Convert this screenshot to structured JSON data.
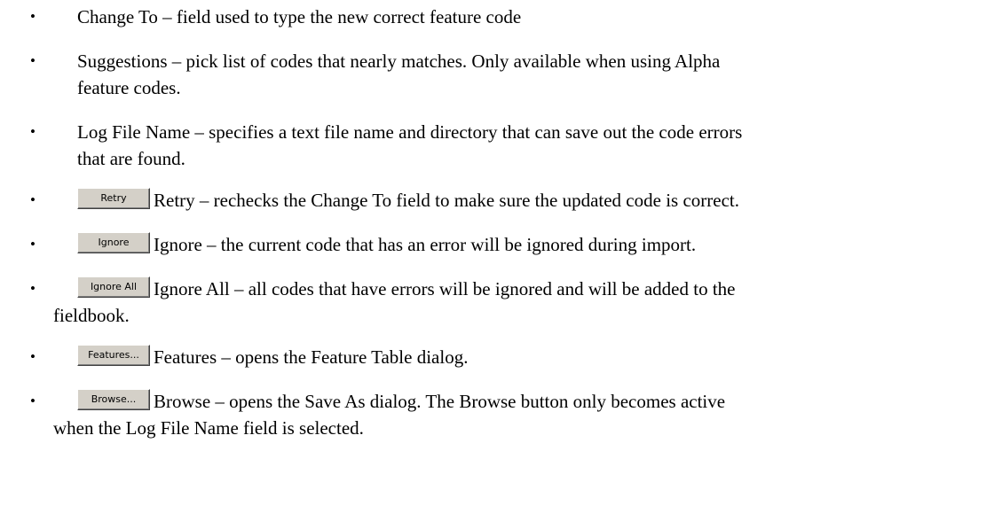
{
  "items": [
    {
      "label": "Change To",
      "desc_line1": "Change To – field used to type the new correct feature code"
    },
    {
      "label": "Suggestions",
      "desc_line1": "Suggestions – pick list of codes that nearly matches.  Only available when using Alpha",
      "desc_line2": "feature codes."
    },
    {
      "label": "Log File Name",
      "desc_line1": "Log File Name – specifies a text file name and directory that can save out the code errors",
      "desc_line2": "that are found."
    },
    {
      "button_label": "Retry",
      "desc_line1": "Retry – rechecks the Change To field to make sure the updated code is correct."
    },
    {
      "button_label": "Ignore",
      "desc_line1": "Ignore – the current code that has an error will be ignored during import."
    },
    {
      "button_label": "Ignore All",
      "desc_line1": "Ignore All – all codes that have errors will be ignored and will be added to the",
      "desc_line2": "fieldbook."
    },
    {
      "button_label": "Features...",
      "desc_line1": "Features – opens the Feature Table dialog."
    },
    {
      "button_label": "Browse...",
      "desc_line1": "Browse – opens the Save As dialog.  The Browse button only becomes active",
      "desc_line2": "when the Log File Name field is selected."
    }
  ],
  "bullet_glyph": "•"
}
